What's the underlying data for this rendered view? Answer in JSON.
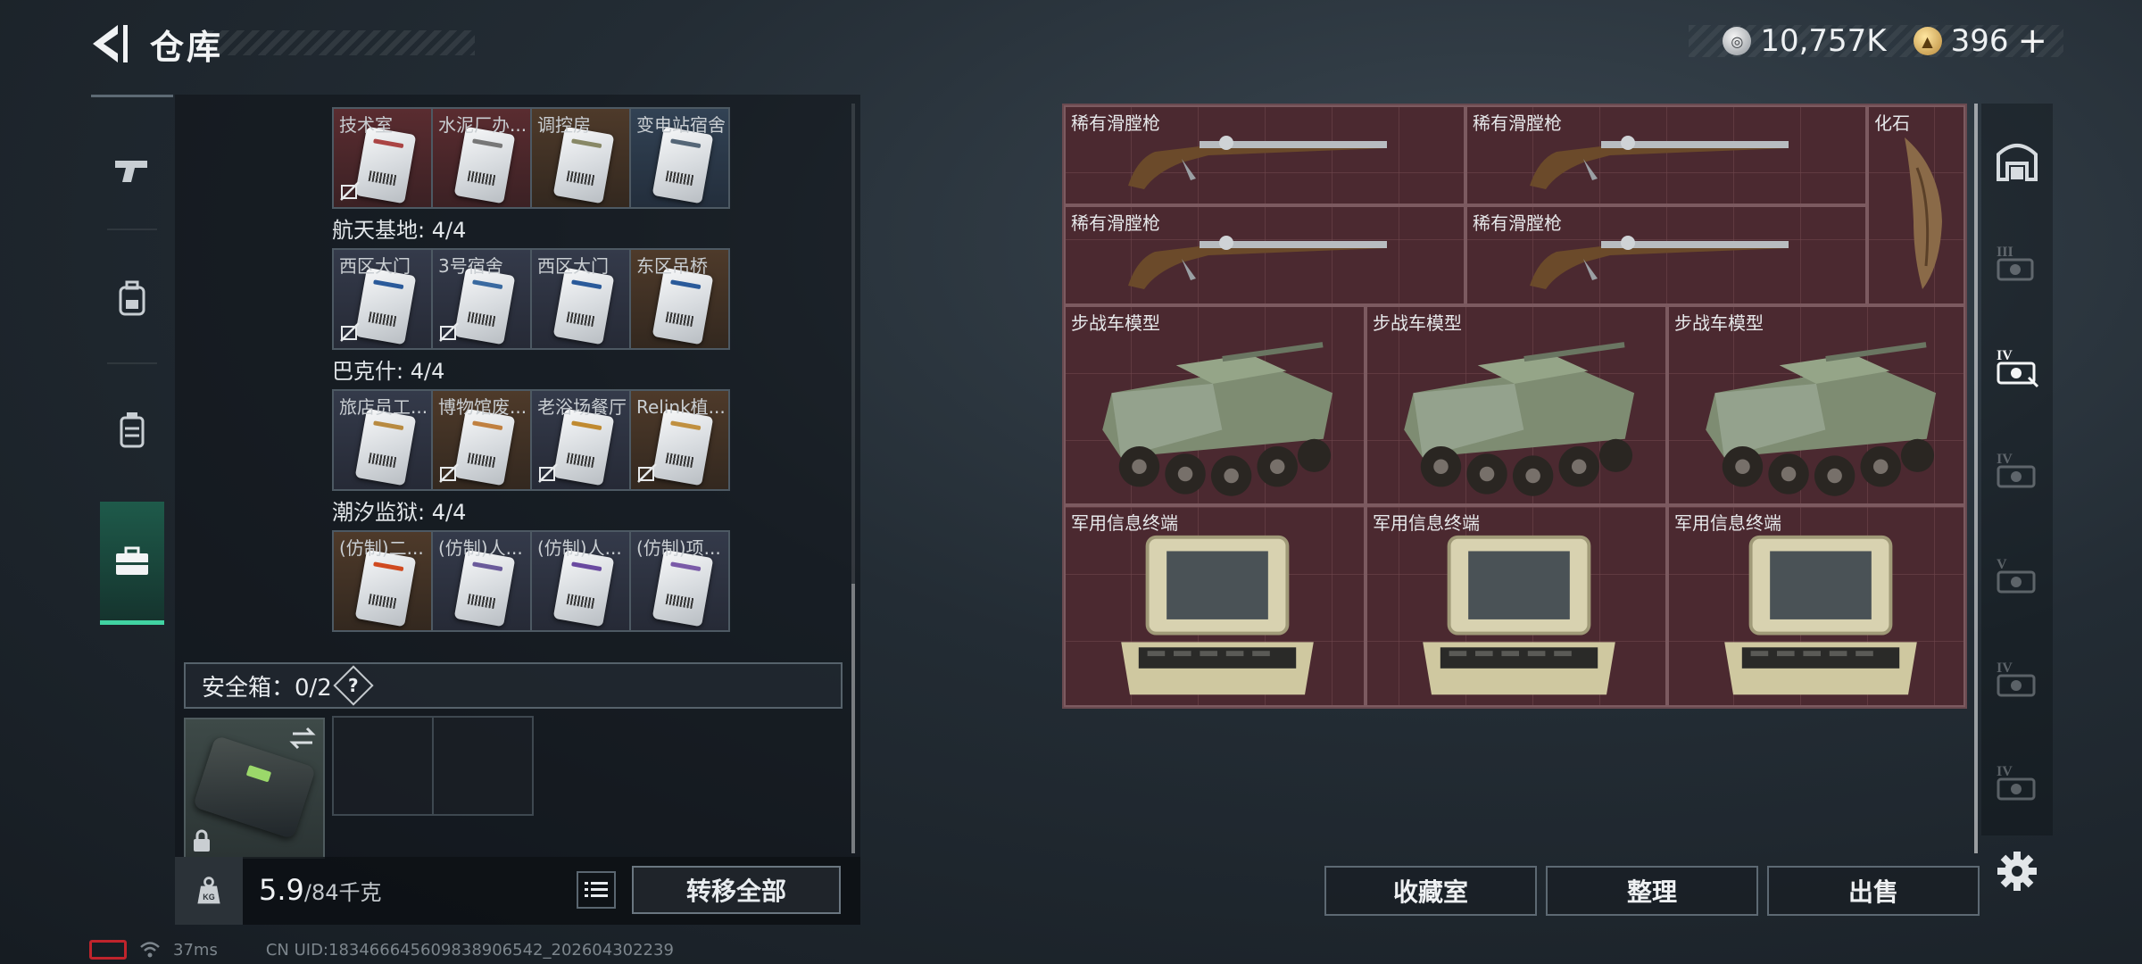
{
  "header": {
    "title": "仓库",
    "currency": [
      {
        "icon": "silver-coin-icon",
        "value": "10,757K"
      },
      {
        "icon": "gold-coin-icon",
        "value": "396"
      }
    ],
    "plus": "+"
  },
  "left_tabs": [
    {
      "icon": "pistol-icon"
    },
    {
      "icon": "backpack-icon"
    },
    {
      "icon": "vest-icon"
    },
    {
      "icon": "toolbox-icon",
      "active": true
    }
  ],
  "key_groups": [
    {
      "label": "",
      "cards": [
        {
          "name": "技术室",
          "bg": "red",
          "stripe": "#a44",
          "no_drop": true
        },
        {
          "name": "水泥厂办...",
          "bg": "red",
          "stripe": "#777",
          "no_drop": false
        },
        {
          "name": "调控房",
          "bg": "brown",
          "stripe": "#886",
          "no_drop": false
        },
        {
          "name": "变电站宿舍",
          "bg": "blue",
          "stripe": "#567",
          "no_drop": false
        }
      ]
    },
    {
      "label": "航天基地: 4/4",
      "cards": [
        {
          "name": "西区大门",
          "bg": "slate",
          "stripe": "#2a5a9a",
          "no_drop": true
        },
        {
          "name": "3号宿舍",
          "bg": "slate",
          "stripe": "#3a6aa0",
          "no_drop": true
        },
        {
          "name": "西区大门",
          "bg": "slate",
          "stripe": "#2a5a9a",
          "no_drop": false
        },
        {
          "name": "东区吊桥",
          "bg": "brown",
          "stripe": "#2a5a9a",
          "no_drop": false
        }
      ]
    },
    {
      "label": "巴克什: 4/4",
      "cards": [
        {
          "name": "旅店员工...",
          "bg": "slate",
          "stripe": "#b88a40",
          "no_drop": false
        },
        {
          "name": "博物馆废...",
          "bg": "brown",
          "stripe": "#c08040",
          "no_drop": true
        },
        {
          "name": "老浴场餐厅",
          "bg": "slate",
          "stripe": "#c08a30",
          "no_drop": true
        },
        {
          "name": "Relink植...",
          "bg": "brown",
          "stripe": "#c09040",
          "no_drop": true
        }
      ]
    },
    {
      "label": "潮汐监狱: 4/4",
      "cards": [
        {
          "name": "(仿制)二...",
          "bg": "brown",
          "stripe": "#d04a20",
          "no_drop": false
        },
        {
          "name": "(仿制)人...",
          "bg": "slate",
          "stripe": "#6a5a9a",
          "no_drop": false
        },
        {
          "name": "(仿制)人...",
          "bg": "slate",
          "stripe": "#6a4aa0",
          "no_drop": false
        },
        {
          "name": "(仿制)项...",
          "bg": "slate",
          "stripe": "#7a5aa8",
          "no_drop": false
        }
      ]
    }
  ],
  "safebox": {
    "label": "安全箱：0/2",
    "help": "?"
  },
  "weight": {
    "current": "5.9",
    "max": "/84千克",
    "unit_icon": "KG"
  },
  "transfer_all": "转移全部",
  "status": {
    "ping": "37ms",
    "uid": "CN UID:18346664560983890654​2_202604302239"
  },
  "stash_items": [
    {
      "name": "稀有滑膛枪",
      "type": "musket"
    },
    {
      "name": "稀有滑膛枪",
      "type": "musket"
    },
    {
      "name": "化石",
      "type": "fossil"
    },
    {
      "name": "稀有滑膛枪",
      "type": "musket"
    },
    {
      "name": "稀有滑膛枪",
      "type": "musket"
    },
    {
      "name": "步战车模型",
      "type": "ifv"
    },
    {
      "name": "步战车模型",
      "type": "ifv"
    },
    {
      "name": "步战车模型",
      "type": "ifv"
    },
    {
      "name": "军用信息终端",
      "type": "terminal"
    },
    {
      "name": "军用信息终端",
      "type": "terminal"
    },
    {
      "name": "军用信息终端",
      "type": "terminal"
    }
  ],
  "right_tabs": [
    {
      "icon": "stash-main-icon"
    },
    {
      "icon": "stash-iii-icon"
    },
    {
      "icon": "stash-iv-active-icon"
    },
    {
      "icon": "stash-iv-icon"
    },
    {
      "icon": "stash-v-icon"
    },
    {
      "icon": "stash-iv-2-icon"
    },
    {
      "icon": "stash-iv-3-icon"
    }
  ],
  "bottom_buttons": {
    "collection": "收藏室",
    "sort": "整理",
    "sell": "出售"
  }
}
